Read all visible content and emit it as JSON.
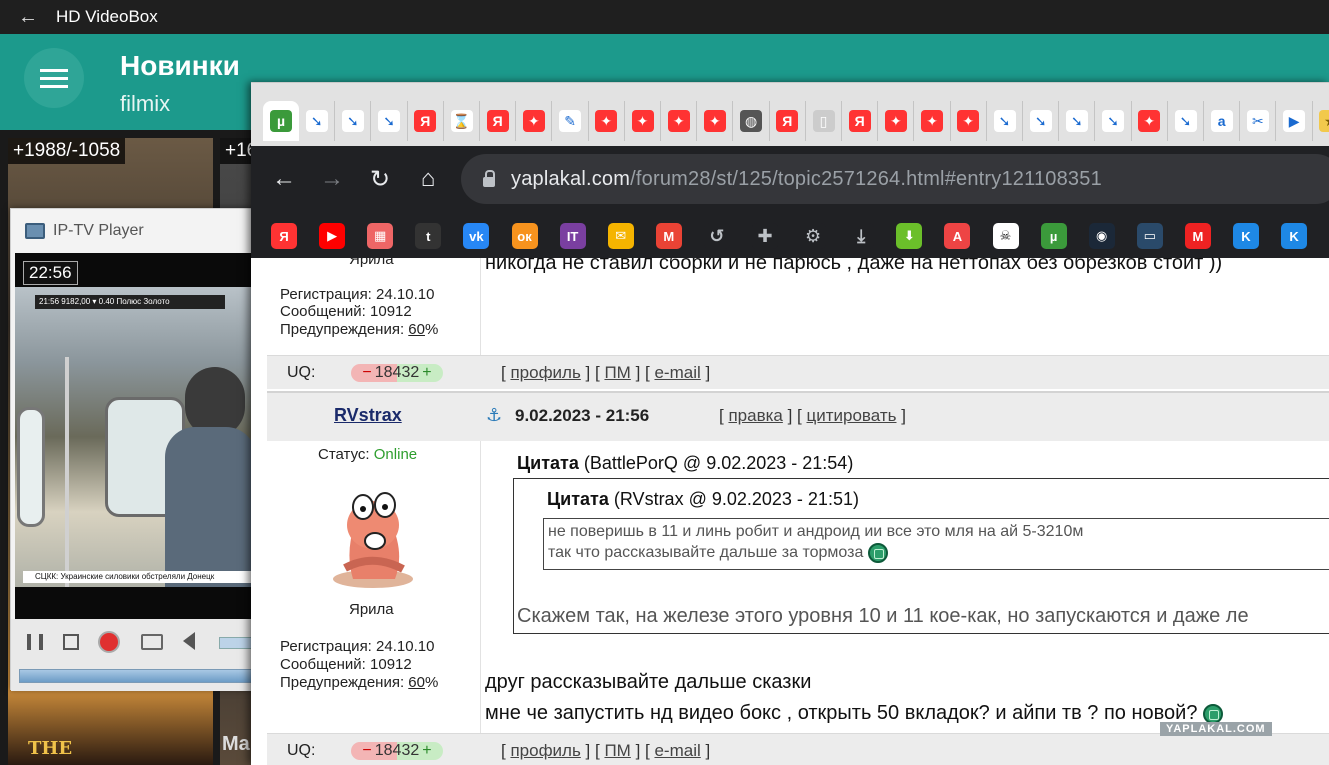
{
  "hdvideobox": {
    "title": "HD VideoBox",
    "header_title": "Новинки",
    "header_subtitle": "filmix",
    "posters": [
      {
        "badge": "+1988/-1058"
      },
      {
        "badge": "+16"
      }
    ],
    "poster_bottom_title": "THE",
    "poster_bottom_fragment": "Ma"
  },
  "iptv": {
    "title": "IP-TV Player",
    "time": "22:56",
    "osd_time": "21:56",
    "osd_info": "9182,00 ▾ 0.40  Полюс Золото",
    "ticker": "СЦКК: Украинские силовики обстреляли Донецк",
    "colors": {
      "record": "#e03030"
    }
  },
  "browser": {
    "url_domain": "yaplakal.com",
    "url_path": "/forum28/st/125/topic2571264.html#entry121108351",
    "tab_icons": [
      "utorrent-icon",
      "yaplakal-arrow-icon",
      "yaplakal-arrow-icon",
      "yaplakal-arrow-icon",
      "yandex-icon",
      "hourglass-icon",
      "yandex-icon",
      "yandex-zen-icon",
      "pencil-icon",
      "yandex-zen-icon",
      "yandex-zen-icon",
      "yandex-zen-icon",
      "yandex-zen-icon",
      "globe-icon",
      "yandex-icon",
      "phone-icon",
      "yandex-icon",
      "yandex-zen-icon",
      "yandex-zen-icon",
      "yandex-zen-icon",
      "yaplakal-arrow-icon",
      "yaplakal-arrow-icon",
      "yaplakal-arrow-icon",
      "yaplakal-arrow-icon",
      "yandex-zen-icon",
      "yaplakal-arrow-icon",
      "amazon-icon",
      "scissors-icon",
      "play-store-icon",
      "star-icon"
    ],
    "bookmark_icons": [
      "yandex-icon",
      "youtube-icon",
      "calculator-icon",
      "tumblr-icon",
      "vk-icon",
      "odnoklassniki-icon",
      "it-icon",
      "mail-icon",
      "gmail-icon",
      "history-icon",
      "puzzle-icon",
      "gear-icon",
      "download-icon",
      "green-arrow-icon",
      "translate-icon",
      "skull-icon",
      "utorrent-icon",
      "steam-icon",
      "monitor-icon",
      "metro-icon",
      "kinopoisk-icon",
      "kinopoisk-icon"
    ]
  },
  "forum": {
    "prev": {
      "user_status": "Ярила",
      "reg_label": "Регистрация:",
      "reg_date": "24.10.10",
      "msg_label": "Сообщений:",
      "msg_count": "10912",
      "warn_label": "Предупреждения:",
      "warn_value": "60",
      "warn_suffix": "%",
      "post_text": "никогда не ставил сборки и не парюсь , даже на неттопах без обрезков стоит ))"
    },
    "uq_label": "UQ:",
    "uq_value": "18432",
    "uq_minus": "−",
    "uq_plus": "+",
    "link_profile": "профиль",
    "link_pm": "ПМ",
    "link_email": "e-mail",
    "post": {
      "author": "RVstrax",
      "date": "9.02.2023 - 21:56",
      "link_edit": "правка",
      "link_quote": "цитировать",
      "status_label": "Статус:",
      "status_value": "Online",
      "rank": "Ярила",
      "reg_label": "Регистрация:",
      "reg_date": "24.10.10",
      "msg_label": "Сообщений:",
      "msg_count": "10912",
      "warn_label": "Предупреждения:",
      "warn_value": "60",
      "warn_suffix": "%",
      "quote1_label": "Цитата",
      "quote1_meta": "(BattlePorQ @ 9.02.2023 - 21:54)",
      "quote2_label": "Цитата",
      "quote2_meta": "(RVstrax @ 9.02.2023 - 21:51)",
      "inner_line1": "не поверишь в 11 и линь робит и андроид ии все это мля на ай 5-3210м",
      "inner_line2": "так что рассказывайте дальше за тормоза",
      "quote1_text": "Скажем так, на железе этого уровня 10 и 11 кое-как, но запускаются и даже ле",
      "reply_line1": "друг рассказывайте дальше сказки",
      "reply_line2": "мне че запустить нд видео бокс , открыть 50 вкладок? и айпи тв ? по новой?"
    },
    "watermark": "YAPLAKAL.COM",
    "colors": {
      "online": "#2e9e2e",
      "accent_teal": "#1c9a8c"
    }
  }
}
